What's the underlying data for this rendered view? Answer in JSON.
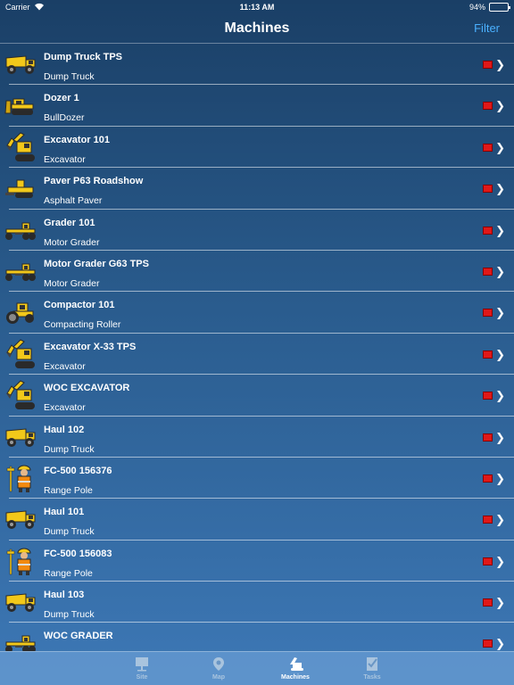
{
  "status_bar": {
    "carrier": "Carrier",
    "time": "11:13 AM",
    "battery": "94%",
    "battery_level": 0.94
  },
  "nav": {
    "title": "Machines",
    "filter_label": "Filter"
  },
  "machines": [
    {
      "name": "Dump Truck TPS",
      "type": "Dump Truck",
      "icon": "dump-truck-icon",
      "status_color": "#e01818"
    },
    {
      "name": "Dozer 1",
      "type": "BullDozer",
      "icon": "bulldozer-icon",
      "status_color": "#e01818"
    },
    {
      "name": "Excavator 101",
      "type": "Excavator",
      "icon": "excavator-icon",
      "status_color": "#e01818"
    },
    {
      "name": "Paver P63 Roadshow",
      "type": "Asphalt Paver",
      "icon": "paver-icon",
      "status_color": "#e01818"
    },
    {
      "name": "Grader 101",
      "type": "Motor Grader",
      "icon": "grader-icon",
      "status_color": "#e01818"
    },
    {
      "name": "Motor Grader G63 TPS",
      "type": "Motor Grader",
      "icon": "grader-icon",
      "status_color": "#e01818"
    },
    {
      "name": "Compactor 101",
      "type": "Compacting Roller",
      "icon": "roller-icon",
      "status_color": "#e01818"
    },
    {
      "name": "Excavator X-33 TPS",
      "type": "Excavator",
      "icon": "excavator-icon",
      "status_color": "#e01818"
    },
    {
      "name": "WOC EXCAVATOR",
      "type": "Excavator",
      "icon": "excavator-icon",
      "status_color": "#e01818"
    },
    {
      "name": "Haul 102",
      "type": "Dump Truck",
      "icon": "dump-truck-icon",
      "status_color": "#e01818"
    },
    {
      "name": "FC-500 156376",
      "type": "Range Pole",
      "icon": "surveyor-icon",
      "status_color": "#e01818"
    },
    {
      "name": "Haul 101",
      "type": "Dump Truck",
      "icon": "dump-truck-icon",
      "status_color": "#e01818"
    },
    {
      "name": "FC-500 156083",
      "type": "Range Pole",
      "icon": "surveyor-icon",
      "status_color": "#e01818"
    },
    {
      "name": "Haul 103",
      "type": "Dump Truck",
      "icon": "dump-truck-icon",
      "status_color": "#e01818"
    },
    {
      "name": "WOC GRADER",
      "type": "",
      "icon": "grader-icon",
      "status_color": "#e01818"
    }
  ],
  "tabs": [
    {
      "label": "Site",
      "icon": "site-icon",
      "active": false
    },
    {
      "label": "Map",
      "icon": "map-icon",
      "active": false
    },
    {
      "label": "Machines",
      "icon": "machines-icon",
      "active": true
    },
    {
      "label": "Tasks",
      "icon": "tasks-icon",
      "active": false
    }
  ],
  "colors": {
    "accent": "#4ab0ff",
    "machine_yellow": "#f2c81a",
    "status_red": "#e01818"
  }
}
